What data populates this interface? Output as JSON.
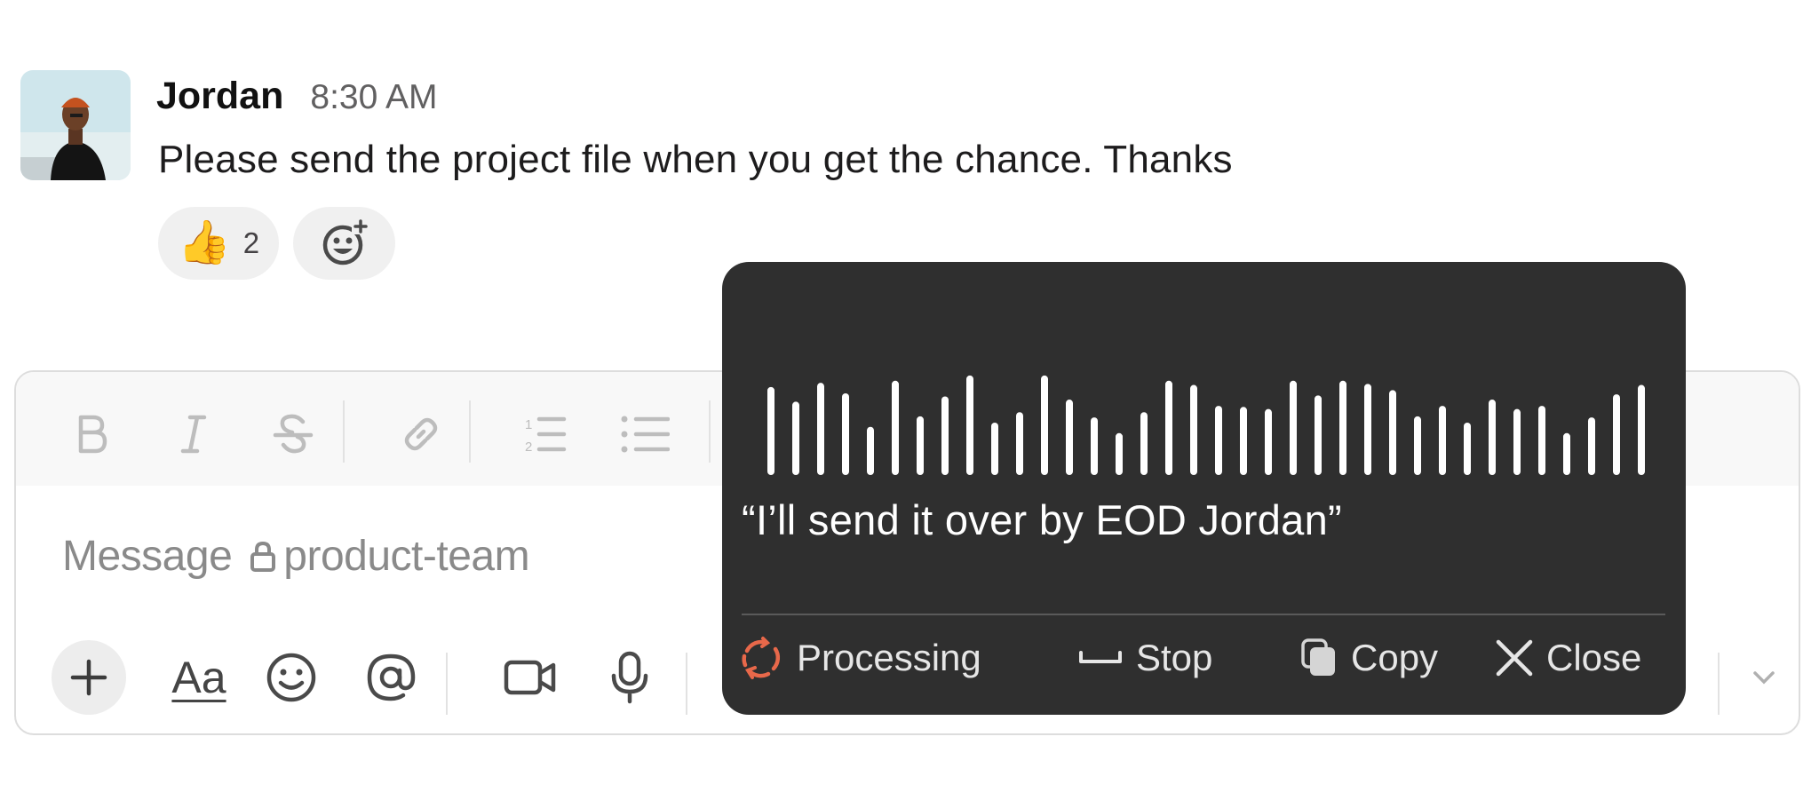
{
  "message": {
    "author": "Jordan",
    "time": "8:30 AM",
    "text": "Please send the project file when you get the chance. Thanks",
    "reactions": [
      {
        "emoji": "👍",
        "count": "2"
      }
    ],
    "add_reaction_icon": "add-reaction-icon"
  },
  "composer": {
    "format_buttons": [
      "bold",
      "italic",
      "strikethrough",
      "link",
      "numbered-list",
      "bulleted-list"
    ],
    "placeholder_prefix": "Message",
    "channel": "product-team",
    "aa_label": "Aa",
    "tools": [
      "plus",
      "format",
      "emoji",
      "mention",
      "video",
      "microphone"
    ]
  },
  "dictation": {
    "transcript": "“I’ll send it over by EOD Jordan”",
    "waveform_levels": [
      0.84,
      0.7,
      0.88,
      0.78,
      0.46,
      0.9,
      0.56,
      0.75,
      0.95,
      0.5,
      0.6,
      0.95,
      0.72,
      0.55,
      0.4,
      0.6,
      0.9,
      0.86,
      0.66,
      0.65,
      0.63,
      0.9,
      0.76,
      0.9,
      0.87,
      0.81,
      0.56,
      0.66,
      0.5,
      0.72,
      0.63,
      0.66,
      0.4,
      0.55,
      0.77,
      0.86
    ],
    "processing_label": "Processing",
    "stop_label": "Stop",
    "copy_label": "Copy",
    "close_label": "Close",
    "accent_color": "#e8684a",
    "background_color": "#2f2f2f"
  }
}
